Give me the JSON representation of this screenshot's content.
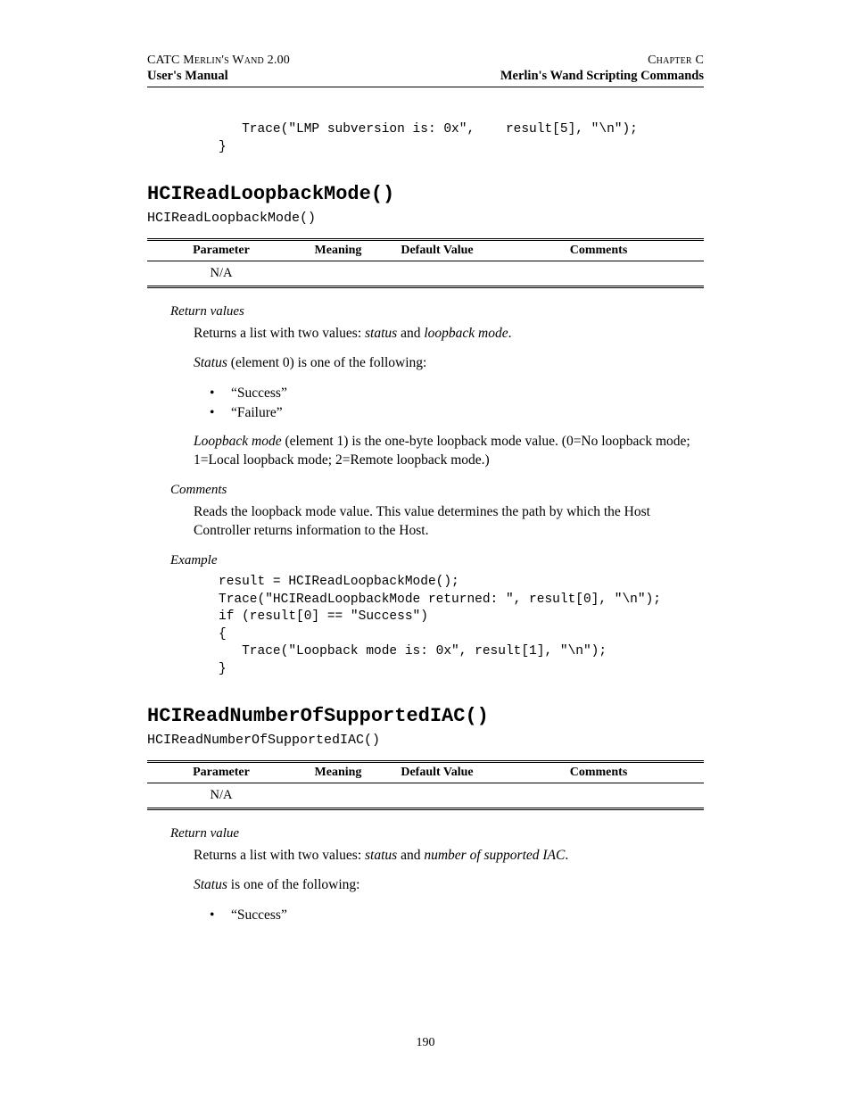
{
  "header": {
    "topLeft": "CATC Merlin's Wand 2.00",
    "topRight": "Chapter C",
    "subLeft": "User's Manual",
    "subRight": "Merlin's Wand Scripting Commands"
  },
  "introCode": "   Trace(\"LMP subversion is: 0x\",    result[5], \"\\n\");\n}",
  "section1": {
    "title": "HCIReadLoopbackMode()",
    "signature": "HCIReadLoopbackMode()",
    "tableHeaders": [
      "Parameter",
      "Meaning",
      "Default Value",
      "Comments"
    ],
    "tableRow": [
      "N/A",
      "",
      "",
      ""
    ],
    "returnHead": "Return values",
    "ret1a": "Returns a list with two values: ",
    "ret1b": "status",
    "ret1c": " and ",
    "ret1d": "loopback mode",
    "ret1e": ".",
    "ret2a": "Status",
    "ret2b": " (element 0) is one of the following:",
    "bullets": [
      "“Success”",
      "“Failure”"
    ],
    "ret3a": "Loopback mode",
    "ret3b": " (element 1) is the one-byte loopback mode value. (0=No loopback mode; 1=Local loopback mode; 2=Remote loopback mode.)",
    "commentsHead": "Comments",
    "commentsBody": "Reads the loopback mode value. This value determines the path by which the Host Controller returns information to the Host.",
    "exampleHead": "Example",
    "exampleCode": "result = HCIReadLoopbackMode();\nTrace(\"HCIReadLoopbackMode returned: \", result[0], \"\\n\");\nif (result[0] == \"Success\")\n{\n   Trace(\"Loopback mode is: 0x\", result[1], \"\\n\");\n}"
  },
  "section2": {
    "title": "HCIReadNumberOfSupportedIAC()",
    "signature": "HCIReadNumberOfSupportedIAC()",
    "tableHeaders": [
      "Parameter",
      "Meaning",
      "Default Value",
      "Comments"
    ],
    "tableRow": [
      "N/A",
      "",
      "",
      ""
    ],
    "returnHead": "Return value",
    "ret1a": "Returns a list with two values: ",
    "ret1b": "status",
    "ret1c": " and ",
    "ret1d": "number of supported IAC",
    "ret1e": ".",
    "ret2a": "Status",
    "ret2b": " is one of the following:",
    "bullets": [
      "“Success”"
    ]
  },
  "pageNumber": "190"
}
